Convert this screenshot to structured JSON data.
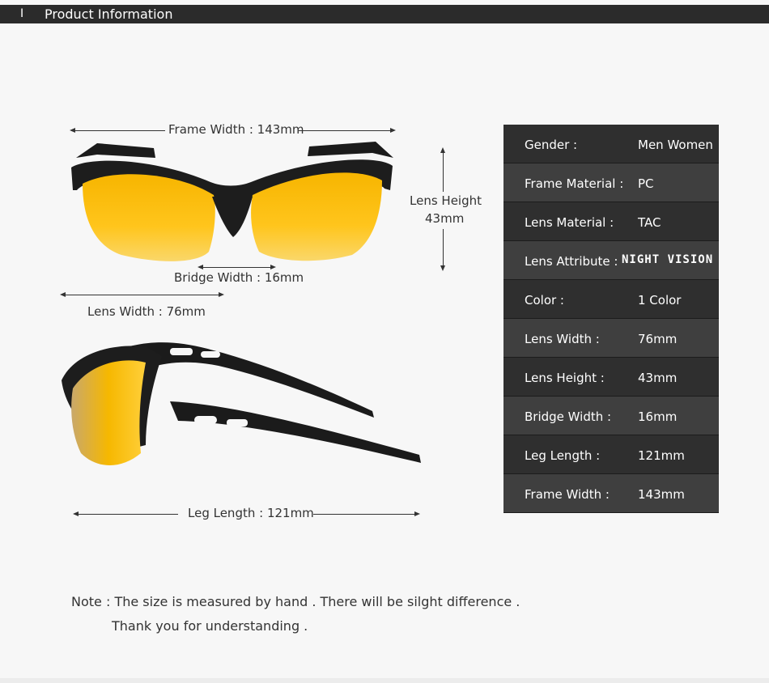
{
  "header": {
    "marker": "I",
    "title": "Product Information"
  },
  "dimensions": {
    "frame_width": "Frame Width : 143mm",
    "lens_height_line1": "Lens Height",
    "lens_height_line2": "43mm",
    "bridge_width": "Bridge Width : 16mm",
    "lens_width": "Lens Width : 76mm",
    "leg_length": "Leg Length : 121mm"
  },
  "specs": [
    {
      "key": "Gender :",
      "value": "Men Women"
    },
    {
      "key": "Frame Material :",
      "value": "PC"
    },
    {
      "key": "Lens Material :",
      "value": "TAC"
    },
    {
      "key": "Lens Attribute :",
      "value": "NIGHT VISION"
    },
    {
      "key": "Color :",
      "value": "1 Color"
    },
    {
      "key": "Lens Width :",
      "value": "76mm"
    },
    {
      "key": "Lens Height :",
      "value": "43mm"
    },
    {
      "key": "Bridge Width :",
      "value": "16mm"
    },
    {
      "key": "Leg Length :",
      "value": "121mm"
    },
    {
      "key": "Frame Width :",
      "value": "143mm"
    }
  ],
  "note": {
    "line1": "Note : The size is measured by hand . There will be silght difference .",
    "line2": "Thank you for understanding ."
  },
  "colors": {
    "lens": "#f6b800",
    "frame": "#1a1a1a",
    "table_dark": "#2f2f2f",
    "table_light": "#3f3f3f"
  }
}
